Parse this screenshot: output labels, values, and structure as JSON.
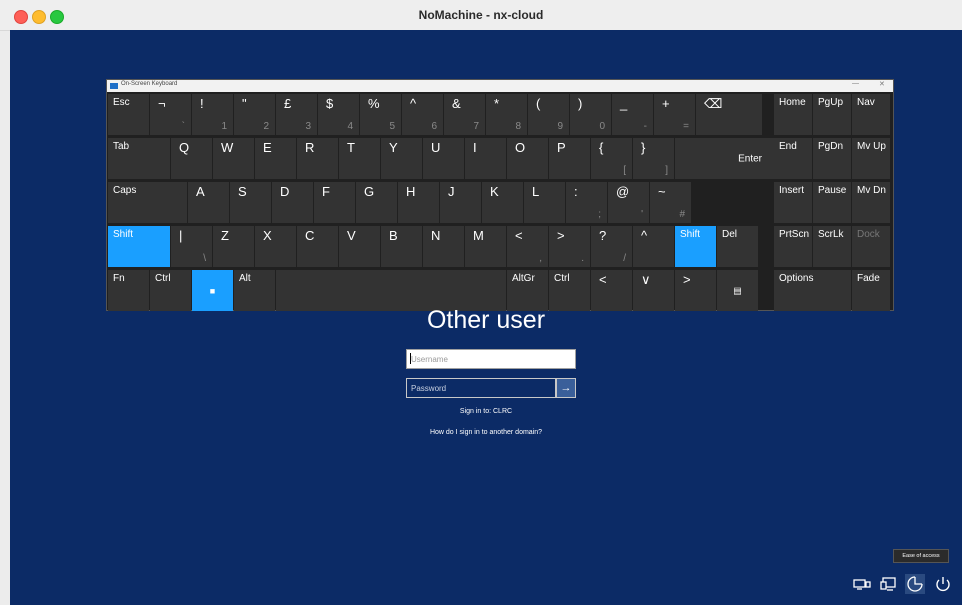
{
  "window": {
    "title": "NoMachine - nx-cloud"
  },
  "osk": {
    "title": "On-Screen Keyboard",
    "controls": {
      "minimize": "—",
      "close": "✕"
    },
    "row1": [
      {
        "id": "esc",
        "main": "Esc"
      },
      {
        "id": "not",
        "main": "¬",
        "sub": "`"
      },
      {
        "id": "1",
        "main": "!",
        "sub": "1"
      },
      {
        "id": "2",
        "main": "\"",
        "sub": "2"
      },
      {
        "id": "3",
        "main": "£",
        "sub": "3"
      },
      {
        "id": "4",
        "main": "$",
        "sub": "4"
      },
      {
        "id": "5",
        "main": "%",
        "sub": "5"
      },
      {
        "id": "6",
        "main": "^",
        "sub": "6"
      },
      {
        "id": "7",
        "main": "&",
        "sub": "7"
      },
      {
        "id": "8",
        "main": "*",
        "sub": "8"
      },
      {
        "id": "9",
        "main": "(",
        "sub": "9"
      },
      {
        "id": "0",
        "main": ")",
        "sub": "0"
      },
      {
        "id": "minus",
        "main": "_",
        "sub": "-"
      },
      {
        "id": "equals",
        "main": "+",
        "sub": "="
      },
      {
        "id": "backspace",
        "main": "⌫"
      }
    ],
    "row2": [
      {
        "id": "tab",
        "main": "Tab"
      },
      {
        "id": "q",
        "main": "Q"
      },
      {
        "id": "w",
        "main": "W"
      },
      {
        "id": "e",
        "main": "E"
      },
      {
        "id": "r",
        "main": "R"
      },
      {
        "id": "t",
        "main": "T"
      },
      {
        "id": "y",
        "main": "Y"
      },
      {
        "id": "u",
        "main": "U"
      },
      {
        "id": "i",
        "main": "I"
      },
      {
        "id": "o",
        "main": "O"
      },
      {
        "id": "p",
        "main": "P"
      },
      {
        "id": "lbrace",
        "main": "{",
        "sub": "["
      },
      {
        "id": "rbrace",
        "main": "}",
        "sub": "]"
      }
    ],
    "enter": "Enter",
    "row3": [
      {
        "id": "caps",
        "main": "Caps"
      },
      {
        "id": "a",
        "main": "A"
      },
      {
        "id": "s",
        "main": "S"
      },
      {
        "id": "d",
        "main": "D"
      },
      {
        "id": "f",
        "main": "F"
      },
      {
        "id": "g",
        "main": "G"
      },
      {
        "id": "h",
        "main": "H"
      },
      {
        "id": "j",
        "main": "J"
      },
      {
        "id": "k",
        "main": "K"
      },
      {
        "id": "l",
        "main": "L"
      },
      {
        "id": "colon",
        "main": ":",
        "sub": ";"
      },
      {
        "id": "at",
        "main": "@",
        "sub": "'"
      },
      {
        "id": "tilde",
        "main": "~",
        "sub": "#"
      }
    ],
    "row4": [
      {
        "id": "lshift",
        "main": "Shift"
      },
      {
        "id": "pipe",
        "main": "|",
        "sub": "\\"
      },
      {
        "id": "z",
        "main": "Z"
      },
      {
        "id": "x",
        "main": "X"
      },
      {
        "id": "c",
        "main": "C"
      },
      {
        "id": "v",
        "main": "V"
      },
      {
        "id": "b",
        "main": "B"
      },
      {
        "id": "n",
        "main": "N"
      },
      {
        "id": "m",
        "main": "M"
      },
      {
        "id": "lt",
        "main": "<",
        "sub": ","
      },
      {
        "id": "gt",
        "main": ">",
        "sub": "."
      },
      {
        "id": "question",
        "main": "?",
        "sub": "/"
      },
      {
        "id": "up",
        "main": "^"
      },
      {
        "id": "rshift",
        "main": "Shift"
      },
      {
        "id": "del",
        "main": "Del"
      }
    ],
    "row5": [
      {
        "id": "fn",
        "main": "Fn"
      },
      {
        "id": "ctrl",
        "main": "Ctrl"
      },
      {
        "id": "win",
        "main": "■"
      },
      {
        "id": "alt",
        "main": "Alt"
      },
      {
        "id": "space",
        "main": ""
      },
      {
        "id": "altgr",
        "main": "AltGr"
      },
      {
        "id": "rctrl",
        "main": "Ctrl"
      },
      {
        "id": "left",
        "main": "<"
      },
      {
        "id": "down",
        "main": "∨"
      },
      {
        "id": "right",
        "main": ">"
      },
      {
        "id": "menu",
        "main": "▤"
      }
    ],
    "nav": [
      {
        "id": "home",
        "main": "Home"
      },
      {
        "id": "pgup",
        "main": "PgUp"
      },
      {
        "id": "navkey",
        "main": "Nav"
      },
      {
        "id": "end",
        "main": "End"
      },
      {
        "id": "pgdn",
        "main": "PgDn"
      },
      {
        "id": "mvup",
        "main": "Mv Up"
      },
      {
        "id": "insert",
        "main": "Insert"
      },
      {
        "id": "pause",
        "main": "Pause"
      },
      {
        "id": "mvdn",
        "main": "Mv Dn"
      },
      {
        "id": "prtscn",
        "main": "PrtScn"
      },
      {
        "id": "scrlk",
        "main": "ScrLk"
      },
      {
        "id": "dock",
        "main": "Dock"
      },
      {
        "id": "options",
        "main": "Options"
      },
      {
        "id": "fade",
        "main": "Fade"
      }
    ]
  },
  "login": {
    "heading": "Other user",
    "username_placeholder": "Username",
    "password_placeholder": "Password",
    "submit_icon": "→",
    "sign_in_to": "Sign in to: CLRC",
    "domain_link": "How do I sign in to another domain?"
  },
  "tray": {
    "tooltip": "Ease of access",
    "icons": [
      "network-icon",
      "display-icon",
      "ease-of-access-icon",
      "power-icon"
    ]
  },
  "colors": {
    "screen": "#0c2b66",
    "accent": "#1a9fff",
    "key": "#333333"
  }
}
